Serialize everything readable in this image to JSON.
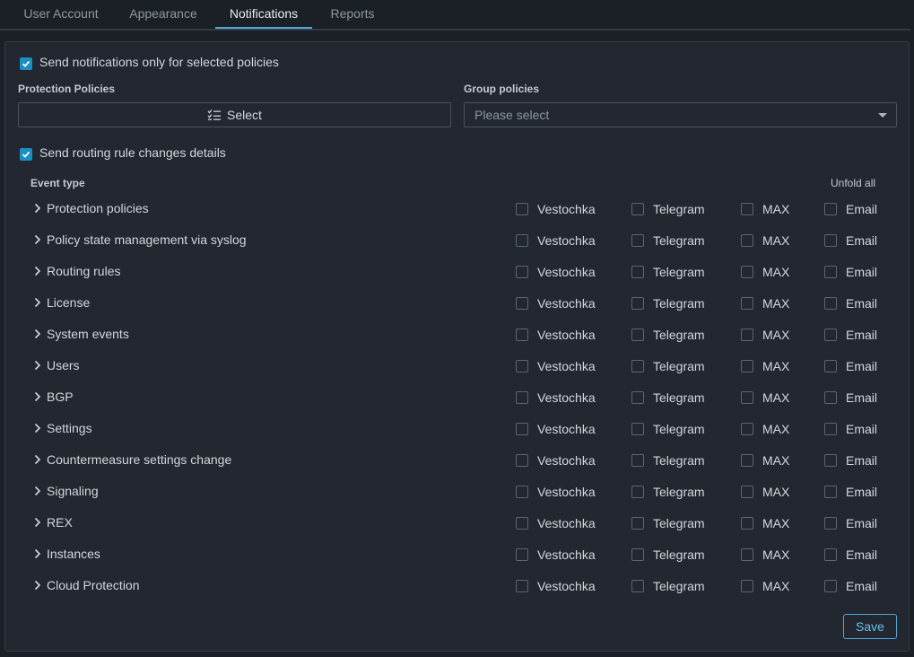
{
  "tabs": [
    {
      "label": "User Account"
    },
    {
      "label": "Appearance"
    },
    {
      "label": "Notifications"
    },
    {
      "label": "Reports"
    }
  ],
  "active_tab": "Notifications",
  "options": {
    "only_selected_label": "Send notifications only for selected policies",
    "routing_changes_label": "Send routing rule changes details"
  },
  "protection_policies": {
    "label": "Protection Policies",
    "button_label": "Select"
  },
  "group_policies": {
    "label": "Group policies",
    "placeholder": "Please select"
  },
  "table": {
    "header_event": "Event type",
    "unfold_all": "Unfold all",
    "channels": [
      "Vestochka",
      "Telegram",
      "MAX",
      "Email"
    ],
    "rows": [
      {
        "name": "Protection policies"
      },
      {
        "name": "Policy state management via syslog"
      },
      {
        "name": "Routing rules"
      },
      {
        "name": "License"
      },
      {
        "name": "System events"
      },
      {
        "name": "Users"
      },
      {
        "name": "BGP"
      },
      {
        "name": "Settings"
      },
      {
        "name": "Countermeasure settings change"
      },
      {
        "name": "Signaling"
      },
      {
        "name": "REX"
      },
      {
        "name": "Instances"
      },
      {
        "name": "Cloud Protection"
      }
    ]
  },
  "save_label": "Save",
  "colors": {
    "accent": "#1b8fc2",
    "active_tab_underline": "#4fa8d6",
    "panel_bg": "#222730",
    "page_bg": "#1b1f26"
  }
}
